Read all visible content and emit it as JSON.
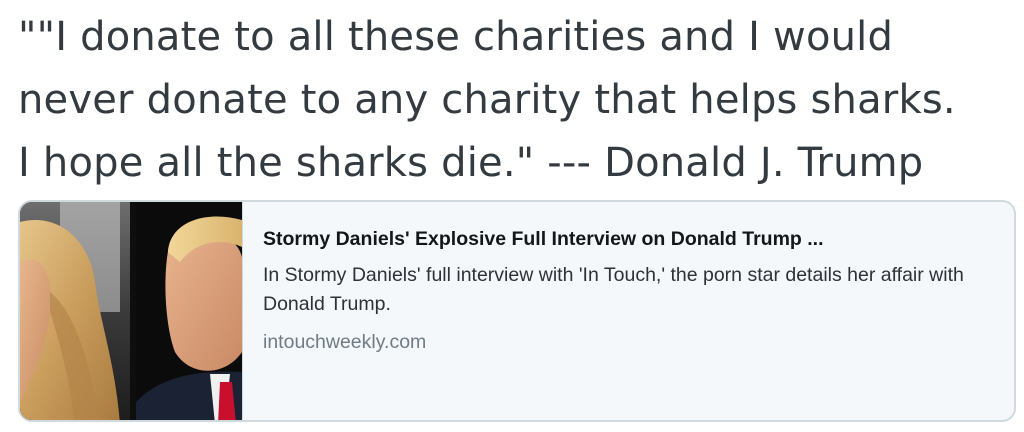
{
  "tweet": {
    "text": "\"\"I donate to all these charities and I would\nnever donate to any charity that helps sharks.\nI hope all the sharks die.\" --- Donald J. Trump"
  },
  "card": {
    "title": "Stormy Daniels' Explosive Full Interview on Donald Trump ...",
    "description": "In Stormy Daniels' full interview with 'In Touch,' the porn star details her affair with Donald Trump.",
    "domain": "intouchweekly.com",
    "image": "photo of a woman with long blonde hair beside a man in a dark suit and red tie"
  },
  "colors": {
    "text": "#333a40",
    "card_border": "#cfd9de",
    "card_bg": "#f5f8fa",
    "domain": "#6f7b85"
  }
}
